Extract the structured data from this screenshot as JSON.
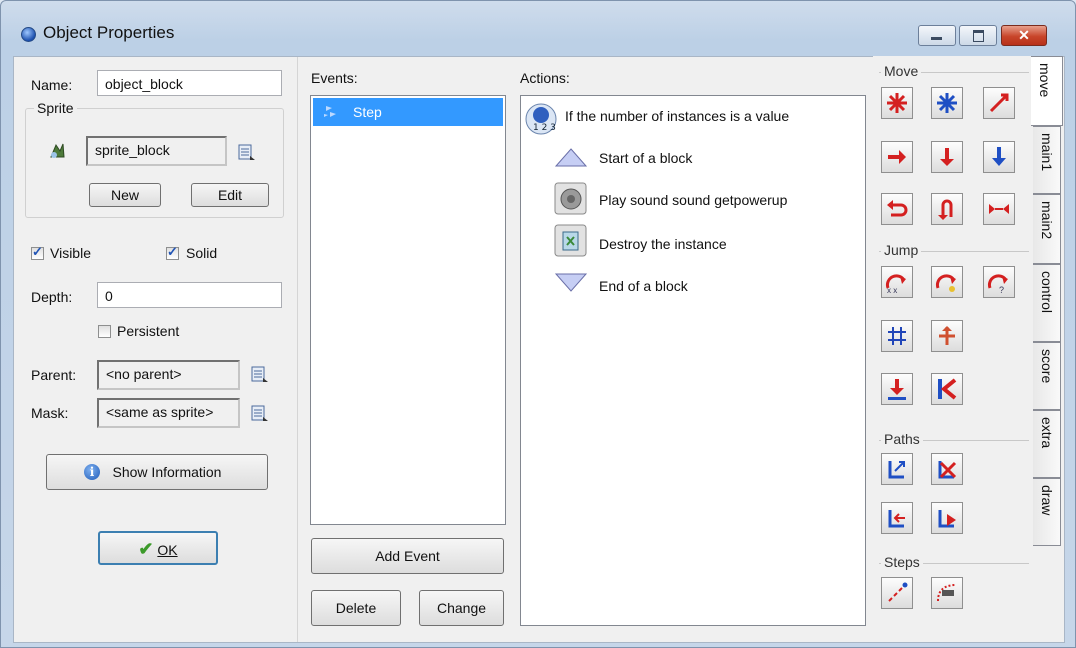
{
  "window": {
    "title": "Object Properties"
  },
  "titlebar": {
    "minimize": "",
    "maximize": "",
    "close": "✕"
  },
  "object": {
    "name_label": "Name:",
    "name_value": "object_block",
    "sprite_group": "Sprite",
    "sprite_value": "sprite_block",
    "new_button": "New",
    "edit_button": "Edit",
    "visible_label": "Visible",
    "solid_label": "Solid",
    "depth_label": "Depth:",
    "depth_value": "0",
    "persistent_label": "Persistent",
    "parent_label": "Parent:",
    "parent_value": "<no parent>",
    "mask_label": "Mask:",
    "mask_value": "<same as sprite>",
    "show_info_button": "Show Information",
    "ok_button": "OK",
    "visible_checked": true,
    "solid_checked": true,
    "persistent_checked": false
  },
  "events": {
    "header": "Events:",
    "items": [
      "Step"
    ],
    "add_event_button": "Add Event",
    "delete_button": "Delete",
    "change_button": "Change"
  },
  "actions": {
    "header": "Actions:",
    "items": [
      "If the number of instances is a value",
      "Start of a block",
      "Play sound sound getpowerup",
      "Destroy the instance",
      "End of a block"
    ]
  },
  "library": {
    "sections": [
      "Move",
      "Jump",
      "Paths",
      "Steps"
    ],
    "tabs": [
      "move",
      "main1",
      "main2",
      "control",
      "score",
      "extra",
      "draw"
    ]
  }
}
